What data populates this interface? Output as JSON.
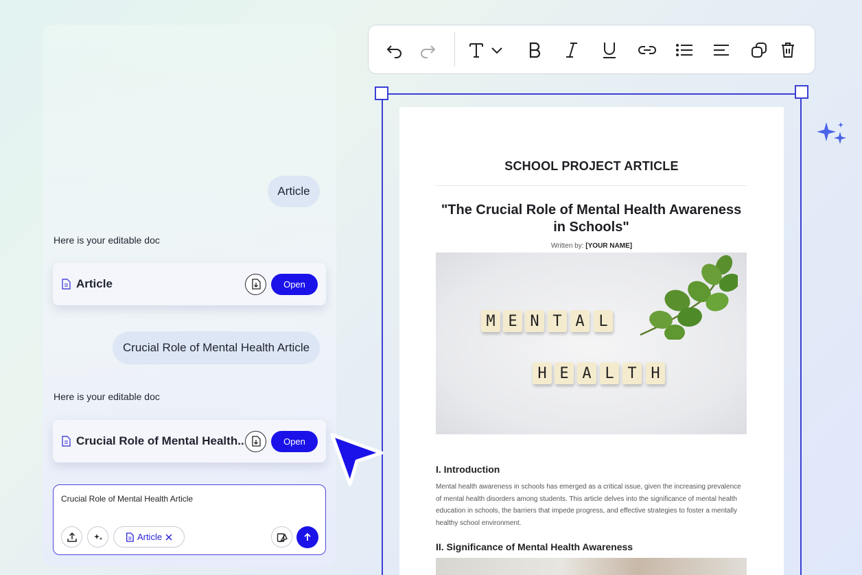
{
  "chat": {
    "user_msg_1": "Article",
    "assistant_msg_1": "Here is your editable doc",
    "doc_card_1": {
      "title": "Article",
      "open_label": "Open"
    },
    "user_msg_2": "Crucial Role of Mental Health Article",
    "assistant_msg_2": "Here is your editable doc",
    "doc_card_2": {
      "title": "Crucial Role of Mental Health...",
      "open_label": "Open"
    },
    "composer": {
      "text": "Crucial Role of Mental Health Article",
      "chip_label": "Article"
    }
  },
  "toolbar": {
    "buttons": [
      "undo-icon",
      "redo-icon",
      "text-style-icon",
      "bold-icon",
      "italic-icon",
      "underline-icon",
      "link-icon",
      "bulleted-list-icon",
      "align-left-icon",
      "duplicate-icon",
      "delete-icon"
    ]
  },
  "document": {
    "heading": "SCHOOL PROJECT ARTICLE",
    "title": "\"The Crucial Role of Mental Health Awareness in Schools\"",
    "byline_prefix": "Written by:",
    "byline_name": "[YOUR NAME]",
    "image_tiles_row1": [
      "M",
      "E",
      "N",
      "T",
      "A",
      "L"
    ],
    "image_tiles_row2": [
      "H",
      "E",
      "A",
      "L",
      "T",
      "H"
    ],
    "section_1_heading": "I. Introduction",
    "section_1_body": "Mental health awareness in schools has emerged as a critical issue, given the increasing prevalence of mental health disorders among students. This article delves into the significance of mental health education in schools, the barriers that impede progress, and effective strategies to foster a mentally healthy school environment.",
    "section_2_heading": "II. Significance of Mental Health Awareness"
  },
  "colors": {
    "accent": "#1a12e8",
    "frame": "#3a3fd4",
    "sparkle": "#4a63e8"
  }
}
